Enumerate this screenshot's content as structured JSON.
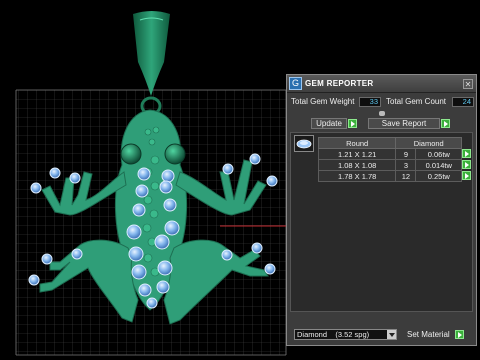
{
  "window": {
    "title": "GEM REPORTER",
    "logo_glyph": "G",
    "close_glyph": "✕"
  },
  "stats": {
    "total_weight_label": "Total Gem Weight",
    "total_weight_value": "33",
    "total_count_label": "Total Gem Count",
    "total_count_value": "24"
  },
  "actions": {
    "update_label": "Update",
    "save_report_label": "Save Report"
  },
  "table": {
    "columns": [
      "Round",
      "Diamond"
    ],
    "rows": [
      {
        "size": "1.21 X 1.21",
        "count": "9",
        "weight": "0.06tw"
      },
      {
        "size": "1.08 X 1.08",
        "count": "3",
        "weight": "0.014tw"
      },
      {
        "size": "1.78 X 1.78",
        "count": "12",
        "weight": "0.25tw"
      }
    ]
  },
  "footer": {
    "material_value": "Diamond    (3.52 spg)",
    "set_material_label": "Set Material"
  },
  "colors": {
    "frog_body": "#2f9e78",
    "gem_blue": "#7fb4ee",
    "accent_green": "#3bb03b",
    "grid_line": "#5a5a5a"
  }
}
